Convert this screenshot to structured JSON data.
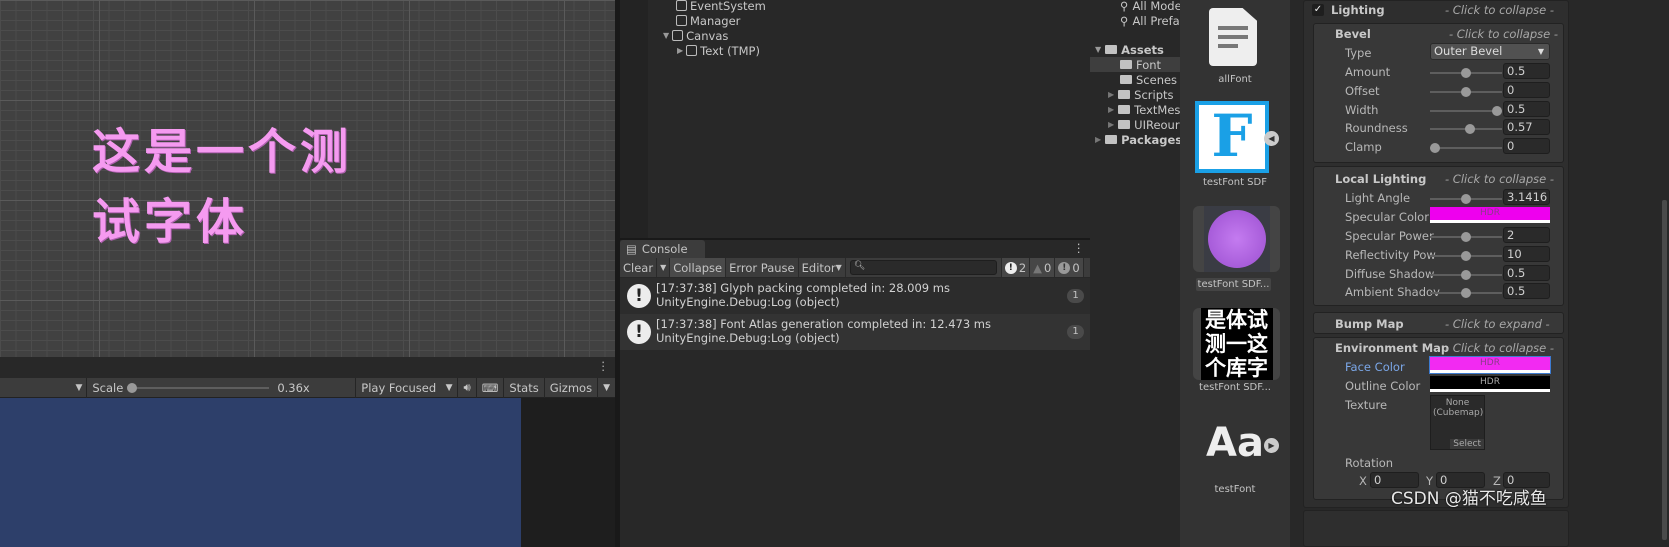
{
  "scene": {
    "text_line1": "这是一个测",
    "text_line2": "试字体"
  },
  "game_toolbar": {
    "scale_label": "Scale",
    "scale_value": "0.36x",
    "scale_fraction": 0.0,
    "play_mode": "Play Focused",
    "stats": "Stats",
    "gizmos": "Gizmos"
  },
  "hierarchy": {
    "items": [
      {
        "label": "EventSystem"
      },
      {
        "label": "Manager"
      },
      {
        "label": "Canvas",
        "expanded": true
      },
      {
        "label": "Text (TMP)",
        "child": true
      }
    ]
  },
  "console": {
    "tab": "Console",
    "clear": "Clear",
    "collapse": "Collapse",
    "error_pause": "Error Pause",
    "editor": "Editor",
    "log_count": "2",
    "warning_count": "0",
    "error_count": "0",
    "messages": [
      {
        "line1": "[17:37:38] Glyph packing completed in: 28.009 ms",
        "line2": "UnityEngine.Debug:Log (object)",
        "count": "1"
      },
      {
        "line1": "[17:37:38] Font Atlas generation completed in: 12.473 ms",
        "line2": "UnityEngine.Debug:Log (object)",
        "count": "1"
      }
    ]
  },
  "project": {
    "search_items": [
      "All Models",
      "All Prefabs"
    ],
    "assets": "Assets",
    "folders": [
      "Font",
      "Scenes",
      "Scripts",
      "TextMesh Pro",
      "UIReource"
    ],
    "selected_folder": "Font",
    "packages": "Packages",
    "grid": [
      {
        "label": "allFont",
        "icon": "text-file-icon"
      },
      {
        "label": "testFont SDF",
        "icon": "font-asset-icon"
      },
      {
        "label": "testFont SDF...",
        "icon": "sdf-atlas-icon"
      },
      {
        "label": "testFont SDF...",
        "icon": "atlas-texture-icon"
      },
      {
        "label": "testFont",
        "icon": "font-icon"
      }
    ],
    "atlas_chars": "是体试测一这个库字",
    "font_glyph": "F",
    "aa_glyph": "Aa"
  },
  "inspector": {
    "lighting": "Lighting",
    "collapse_hint": "- Click to collapse -",
    "expand_hint": "- Click to expand -",
    "bevel": {
      "title": "Bevel",
      "type_label": "Type",
      "type_value": "Outer Bevel",
      "rows": [
        {
          "label": "Amount",
          "value": "0.5",
          "fraction": 0.5
        },
        {
          "label": "Offset",
          "value": "0",
          "fraction": 0.5
        },
        {
          "label": "Width",
          "value": "0.5",
          "fraction": 1.0
        },
        {
          "label": "Roundness",
          "value": "0.57",
          "fraction": 0.57
        },
        {
          "label": "Clamp",
          "value": "0",
          "fraction": 0.0
        }
      ]
    },
    "local_lighting": {
      "title": "Local Lighting",
      "light_angle_label": "Light Angle",
      "light_angle": "3.1416",
      "light_angle_fraction": 0.5,
      "specular_color_label": "Specular Color",
      "specular_color": "#ee00ee",
      "hdr": "HDR",
      "rows": [
        {
          "label": "Specular Power",
          "value": "2",
          "fraction": 0.5
        },
        {
          "label": "Reflectivity Pow",
          "value": "10",
          "fraction": 0.5
        },
        {
          "label": "Diffuse Shadow",
          "value": "0.5",
          "fraction": 0.5
        },
        {
          "label": "Ambient Shadov",
          "value": "0.5",
          "fraction": 0.5
        }
      ]
    },
    "bump_map": "Bump Map",
    "env_map": {
      "title": "Environment Map",
      "face_color_label": "Face Color",
      "face_color": "#f22af2",
      "outline_color_label": "Outline Color",
      "outline_color": "#000000",
      "texture_label": "Texture",
      "texture_value": "None (Cubemap)",
      "select": "Select",
      "rotation_label": "Rotation",
      "x": "0",
      "y": "0",
      "z": "0"
    }
  },
  "watermark": "CSDN @猫不吃咸鱼"
}
